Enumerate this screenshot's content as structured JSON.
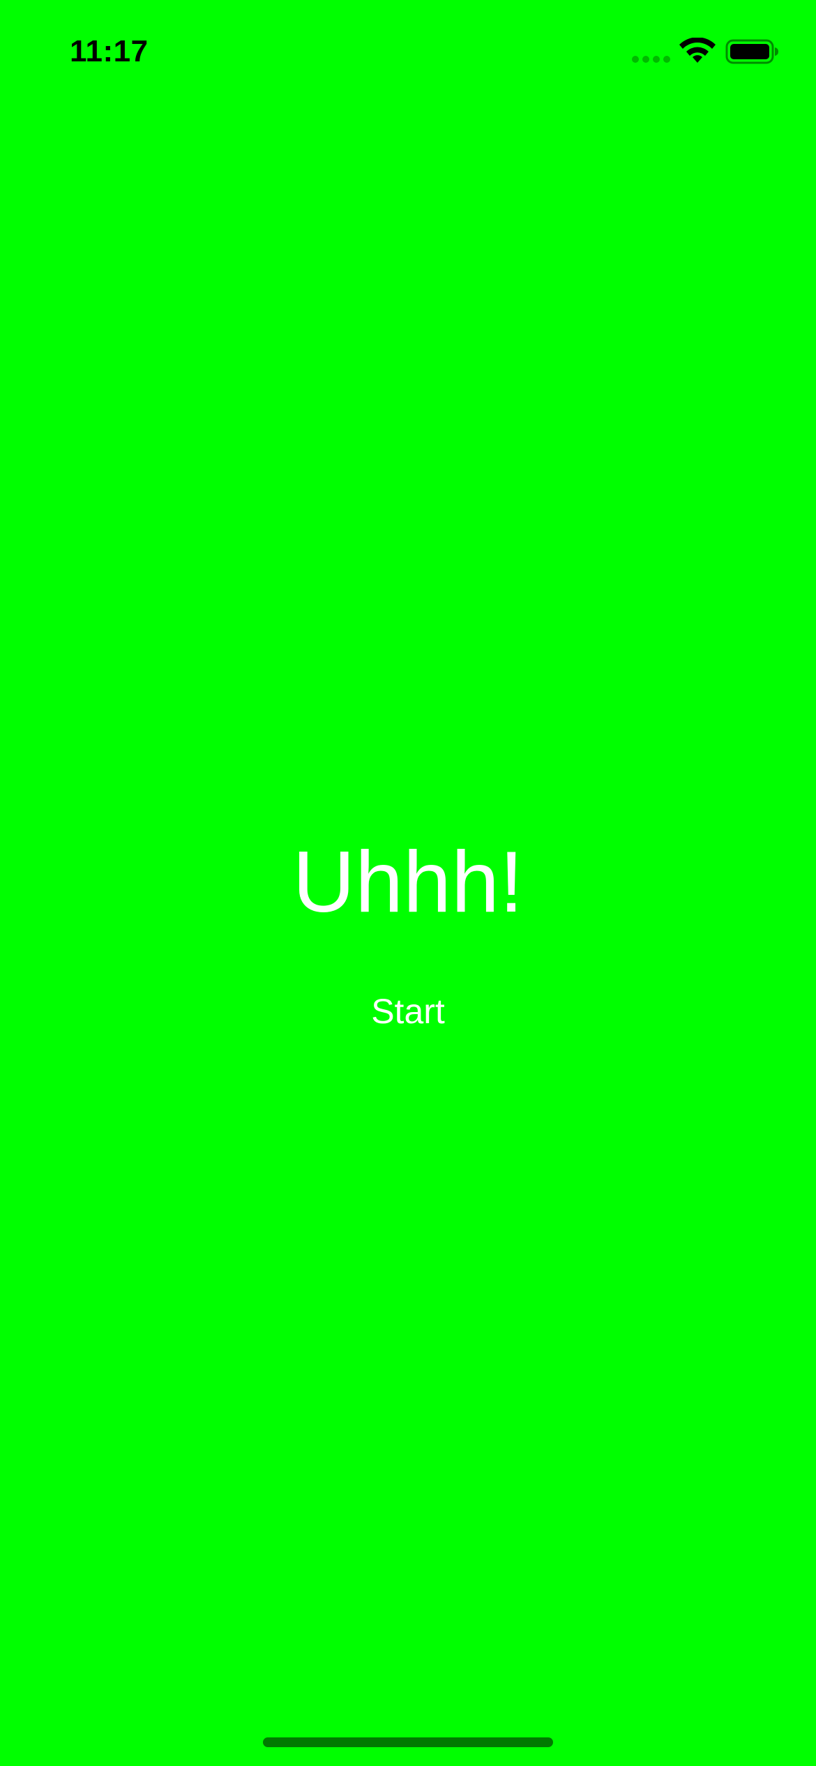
{
  "status_bar": {
    "time": "11:17",
    "icons": [
      "signal-dots-icon",
      "wifi-icon",
      "battery-icon"
    ]
  },
  "main": {
    "headline": "Uhhh!",
    "start_label": "Start"
  },
  "colors": {
    "background": "#00FF00",
    "text": "#FFFFFF",
    "status_text": "#000000",
    "home_indicator": "#007A00"
  }
}
